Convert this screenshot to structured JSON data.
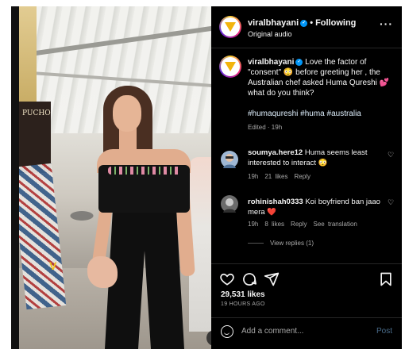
{
  "post": {
    "username": "viralbhayani",
    "follow_status": "Following",
    "audio": "Original audio",
    "caption_user": "viralbhayani",
    "caption_text": "Love the factor of \"consent\" 😳 before greeting her , the Australian chef asked Huma Qureshi 💕 what do you think?",
    "hashtags": "#humaqureshi #huma #australia",
    "edited": "Edited · 19h",
    "likes": "29,531 likes",
    "time_ago": "19 HOURS AGO"
  },
  "video": {
    "shop_sign": "PUCHO"
  },
  "comments": [
    {
      "user": "soumya.here12",
      "text": "Huma seems least interested to interact 😳",
      "age": "19h",
      "likes": "21 likes",
      "reply": "Reply",
      "avatar_color": "#9fb8d4"
    },
    {
      "user": "rohinishah0333",
      "text": "Koi boyfriend ban jaao mera ❤️",
      "age": "19h",
      "likes": "8 likes",
      "reply": "Reply",
      "translate": "See translation",
      "avatar_color": "#6b6b6b"
    }
  ],
  "view_replies": "View replies (1)",
  "composer": {
    "placeholder": "Add a comment...",
    "post_label": "Post"
  },
  "colors": {
    "panel_bg": "#000000",
    "accent_blue": "#0095f6",
    "muted_text": "#a8a8a8",
    "post_disabled": "#4a6d8c"
  },
  "icons": [
    "heart-icon",
    "comment-icon",
    "share-icon",
    "bookmark-icon",
    "more-icon",
    "mute-icon",
    "emoji-icon",
    "verified-icon"
  ]
}
